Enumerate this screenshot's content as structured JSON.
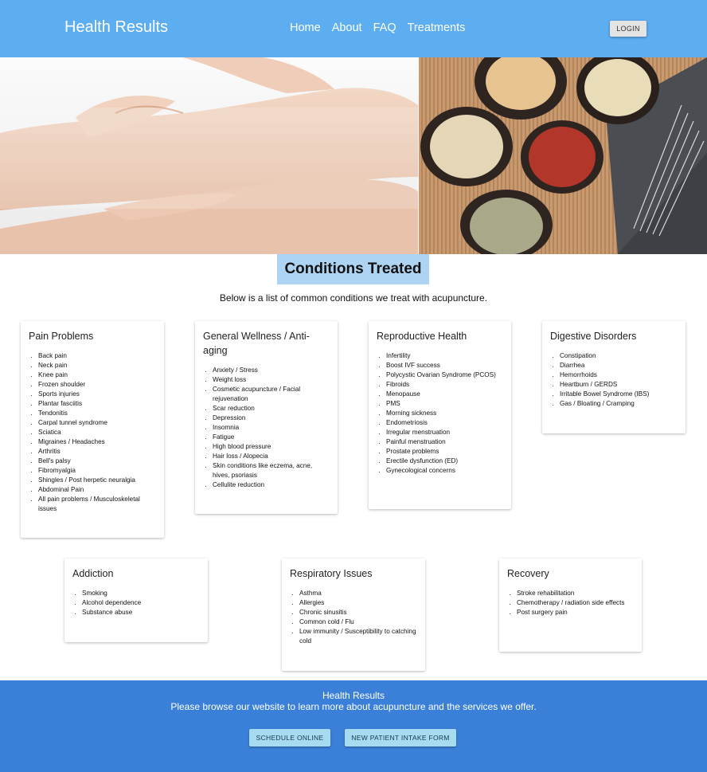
{
  "header": {
    "brand": "Health Results",
    "nav": [
      "Home",
      "About",
      "FAQ",
      "Treatments"
    ],
    "login_label": "LOGIN"
  },
  "main": {
    "title": "Conditions Treated",
    "intro": "Below is a list of common conditions we treat with acupuncture.",
    "cards": [
      {
        "title": "Pain Problems",
        "items": [
          "Back pain",
          "Neck pain",
          "Knee pain",
          "Frozen shoulder",
          "Sports injuries",
          "Plantar fasciitis",
          "Tendonitis",
          "Carpal tunnel syndrome",
          "Sciatica",
          "Migraines / Headaches",
          "Arthritis",
          "Bell's palsy",
          "Fibromyalgia",
          "Shingles / Post herpetic neuralgia",
          "Abdominal Pain",
          "All pain problems / Musculoskeletal issues"
        ]
      },
      {
        "title": "General Wellness / Anti-aging",
        "items": [
          "Anxiety / Stress",
          "Weight loss",
          "Cosmetic acupuncture / Facial rejuvenation",
          "Scar reduction",
          "Depression",
          "Insomnia",
          "Fatigue",
          "High blood pressure",
          "Hair loss / Alopecia",
          "Skin conditions like eczema, acne, hives, psoriasis",
          "Cellulite reduction"
        ]
      },
      {
        "title": "Reproductive Health",
        "items": [
          "Infertility",
          "Boost IVF success",
          "Polycystic Ovarian Syndrome (PCOS)",
          "Fibroids",
          "Menopause",
          "PMS",
          "Morning sickness",
          "Endometriosis",
          "Irregular menstruation",
          "Painful menstruation",
          "Prostate problems",
          "Erectile dysfunction (ED)",
          "Gynecological concerns"
        ]
      },
      {
        "title": "Digestive Disorders",
        "items": [
          "Constipation",
          "Diarrhea",
          "Hemorrhoids",
          "Heartburn / GERDS",
          "Irritable Bowel Syndrome (IBS)",
          "Gas / Bloating / Cramping"
        ]
      },
      {
        "title": "Addiction",
        "items": [
          "Smoking",
          "Alcohol dependence",
          "Substance abuse"
        ]
      },
      {
        "title": "Respiratory Issues",
        "items": [
          "Asthma",
          "Allergies",
          "Chronic sinusitis",
          "Common cold / Flu",
          "Low immunity / Susceptibility to catching cold"
        ]
      },
      {
        "title": "Recovery",
        "items": [
          "Stroke rehabilitation",
          "Chemotherapy / radiation side effects",
          "Post surgery pain"
        ]
      }
    ]
  },
  "footer": {
    "title": "Health Results",
    "text": "Please browse our website to learn more about acupuncture and the services we offer.",
    "buttons": [
      "SCHEDULE ONLINE",
      "NEW PATIENT INTAKE FORM"
    ]
  },
  "colors": {
    "header_bg": "#5daef0",
    "title_bg": "#aed4f3",
    "footer_bg": "#3a80d8",
    "footer_button_bg": "#a7dcf0"
  }
}
